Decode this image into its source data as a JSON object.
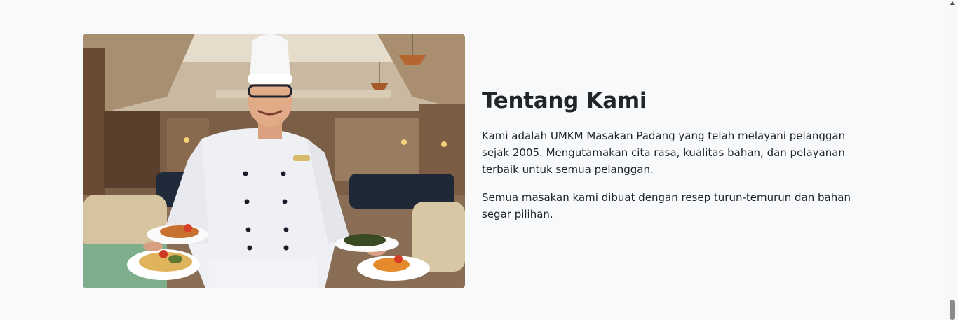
{
  "about": {
    "title": "Tentang Kami",
    "paragraphs": [
      "Kami adalah UMKM Masakan Padang yang telah melayani pelanggan sejak 2005. Mengutamakan cita rasa, kualitas bahan, dan pelayanan terbaik untuk semua pelanggan.",
      "Semua masakan kami dibuat dengan resep turun-temurun dan bahan segar pilihan."
    ]
  },
  "photo": {
    "icon": "chef-photo"
  },
  "colors": {
    "background": "#f8f9fa",
    "text": "#212529"
  }
}
